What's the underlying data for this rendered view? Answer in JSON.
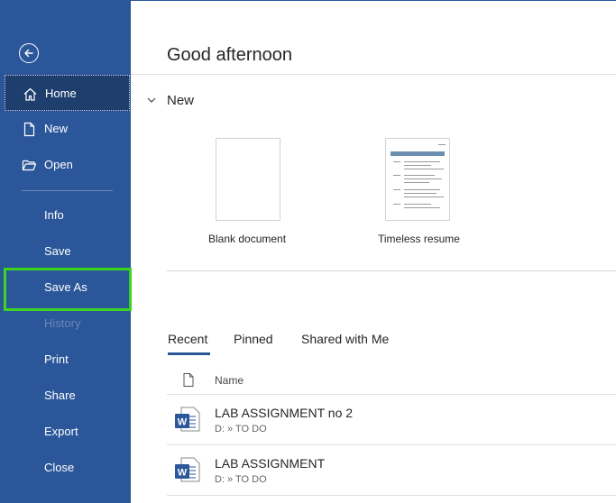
{
  "sidebar": {
    "items": [
      {
        "id": "home",
        "label": "Home",
        "icon": "home-icon"
      },
      {
        "id": "new",
        "label": "New",
        "icon": "new-document-icon"
      },
      {
        "id": "open",
        "label": "Open",
        "icon": "folder-open-icon"
      },
      {
        "id": "info",
        "label": "Info"
      },
      {
        "id": "save",
        "label": "Save"
      },
      {
        "id": "save-as",
        "label": "Save As"
      },
      {
        "id": "history",
        "label": "History",
        "disabled": true
      },
      {
        "id": "print",
        "label": "Print"
      },
      {
        "id": "share",
        "label": "Share"
      },
      {
        "id": "export",
        "label": "Export"
      },
      {
        "id": "close",
        "label": "Close"
      }
    ],
    "active": "home",
    "highlighted": "save-as"
  },
  "header": {
    "greeting": "Good afternoon"
  },
  "new_section": {
    "title": "New",
    "templates": [
      {
        "label": "Blank document"
      },
      {
        "label": "Timeless resume"
      }
    ]
  },
  "tabs": [
    {
      "label": "Recent",
      "active": true
    },
    {
      "label": "Pinned"
    },
    {
      "label": "Shared with Me"
    }
  ],
  "table": {
    "name_header": "Name",
    "files": [
      {
        "name": "LAB ASSIGNMENT no 2",
        "path": "D: » TO DO"
      },
      {
        "name": "LAB ASSIGNMENT",
        "path": "D: » TO DO"
      }
    ]
  },
  "colors": {
    "sidebar": "#2b579a",
    "active_item": "#1e3e6e",
    "highlight": "#3cd41e"
  }
}
